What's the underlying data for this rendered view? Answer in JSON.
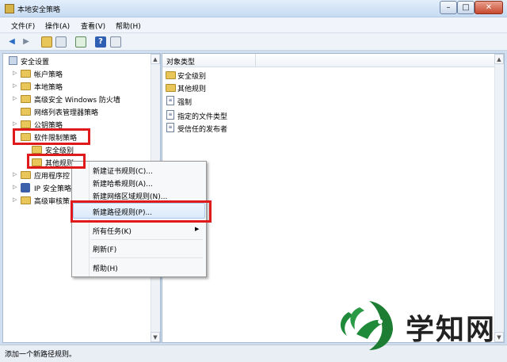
{
  "window": {
    "title": "本地安全策略"
  },
  "menu": [
    "文件(F)",
    "操作(A)",
    "查看(V)",
    "帮助(H)"
  ],
  "tree": {
    "root": "安全设置",
    "items": [
      {
        "label": "帐户策略"
      },
      {
        "label": "本地策略"
      },
      {
        "label": "高级安全 Windows 防火墙"
      },
      {
        "label": "网络列表管理器策略"
      },
      {
        "label": "公钥策略"
      },
      {
        "label": "软件限制策略"
      },
      {
        "label": "安全级别"
      },
      {
        "label": "其他规则"
      },
      {
        "label": "应用程序控"
      },
      {
        "label": "IP 安全策略"
      },
      {
        "label": "高级审核策"
      }
    ]
  },
  "list": {
    "column": "对象类型",
    "items": [
      {
        "label": "安全级别",
        "icon": "folder"
      },
      {
        "label": "其他规则",
        "icon": "folder"
      },
      {
        "label": "强制",
        "icon": "doc"
      },
      {
        "label": "指定的文件类型",
        "icon": "doc"
      },
      {
        "label": "受信任的发布者",
        "icon": "doc"
      }
    ]
  },
  "context_menu": {
    "items": [
      "新建证书规则(C)...",
      "新建哈希规则(A)...",
      "新建网络区域规则(N)...",
      "新建路径规则(P)...",
      "所有任务(K)",
      "刷新(F)",
      "帮助(H)"
    ],
    "highlighted_index": 3
  },
  "status": "添加一个新路径规则。",
  "watermark": {
    "text": "学知网"
  },
  "colors": {
    "highlight_box": "#e01a1a",
    "watermark_green": "#1f8a3a"
  }
}
